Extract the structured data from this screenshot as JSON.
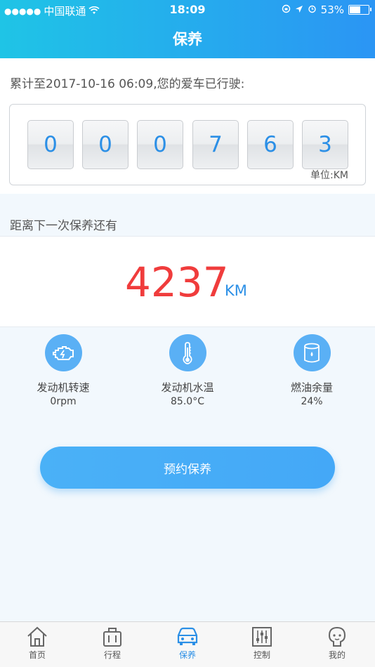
{
  "status_bar": {
    "carrier": "中国联通",
    "time": "18:09",
    "battery": "53%"
  },
  "header": {
    "title": "保养"
  },
  "odometer": {
    "caption": "累计至2017-10-16 06:09,您的爱车已行驶:",
    "digits": [
      "0",
      "0",
      "0",
      "7",
      "6",
      "3"
    ],
    "unit": "单位:KM"
  },
  "next_service": {
    "caption": "距离下一次保养还有",
    "value": "4237",
    "unit": "KM"
  },
  "gauges": [
    {
      "label": "发动机转速",
      "value": "0rpm",
      "icon": "engine-icon"
    },
    {
      "label": "发动机水温",
      "value": "85.0°C",
      "icon": "thermometer-icon"
    },
    {
      "label": "燃油余量",
      "value": "24%",
      "icon": "fuel-barrel-icon"
    }
  ],
  "book_button": "预约保养",
  "tabs": [
    {
      "label": "首页",
      "icon": "home-icon",
      "active": false
    },
    {
      "label": "行程",
      "icon": "luggage-icon",
      "active": false
    },
    {
      "label": "保养",
      "icon": "car-icon",
      "active": true
    },
    {
      "label": "控制",
      "icon": "sliders-icon",
      "active": false
    },
    {
      "label": "我的",
      "icon": "person-icon",
      "active": false
    }
  ],
  "colors": {
    "accent": "#2b8fe6",
    "header_start": "#1fc4e6",
    "header_end": "#2b95f4",
    "remaining_value": "#f03c3c",
    "gauge_circle": "#5ab0f5"
  }
}
